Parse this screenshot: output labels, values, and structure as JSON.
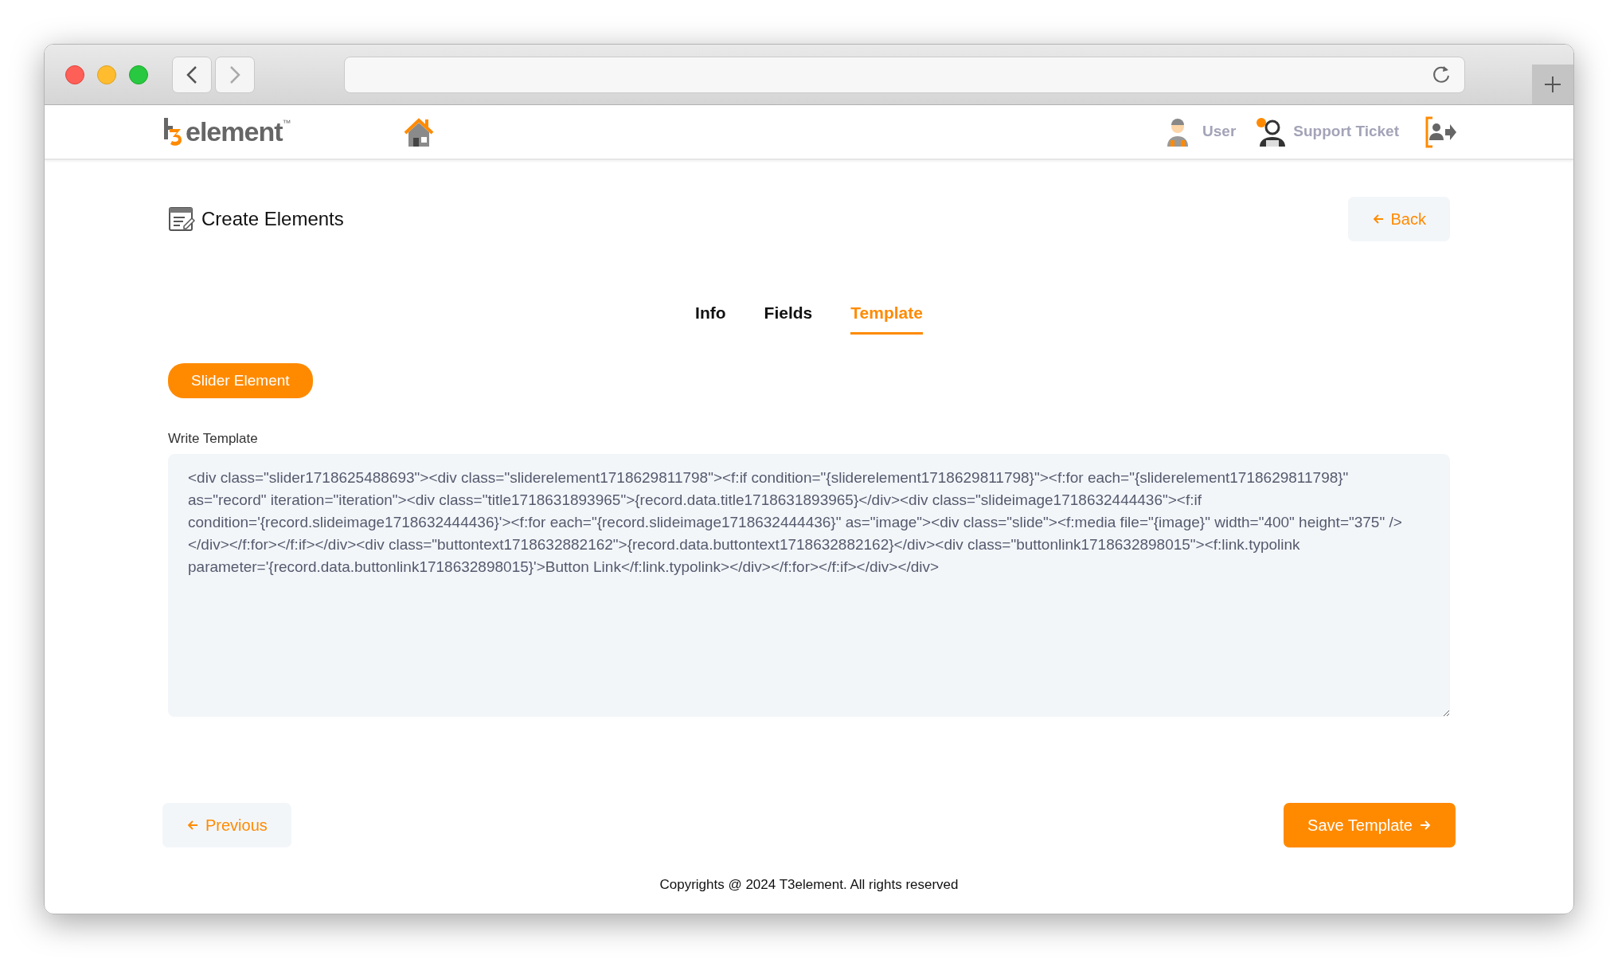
{
  "header": {
    "logo": {
      "word": "element",
      "trademark": "™"
    },
    "nav": [
      {
        "kind": "user",
        "label": "User"
      },
      {
        "kind": "support",
        "label": "Support Ticket"
      }
    ]
  },
  "page": {
    "title": "Create Elements",
    "back": "Back"
  },
  "tabs": [
    {
      "label": "Info",
      "selected": false
    },
    {
      "label": "Fields",
      "selected": false
    },
    {
      "label": "Template",
      "selected": true
    }
  ],
  "element_badge": "Slider Element",
  "template": {
    "label": "Write Template",
    "value": "<div class=\"slider1718625488693\"><div class=\"sliderelement1718629811798\"><f:if condition=\"{sliderelement1718629811798}\"><f:for each=\"{sliderelement1718629811798}\" as=\"record\" iteration=\"iteration\"><div class=\"title1718631893965\">{record.data.title1718631893965}</div><div class=\"slideimage1718632444436\"><f:if condition='{record.slideimage1718632444436}'><f:for each=\"{record.slideimage1718632444436}\" as=\"image\"><div class=\"slide\"><f:media file=\"{image}\" width=\"400\" height=\"375\" /></div></f:for></f:if></div><div class=\"buttontext1718632882162\">{record.data.buttontext1718632882162}</div><div class=\"buttonlink1718632898015\"><f:link.typolink parameter='{record.data.buttonlink1718632898015}'>Button Link</f:link.typolink></div></f:for></f:if></div></div>"
  },
  "buttons": {
    "previous": "Previous",
    "save": "Save Template"
  },
  "footer": "Copyrights @ 2024 T3element. All rights reserved"
}
